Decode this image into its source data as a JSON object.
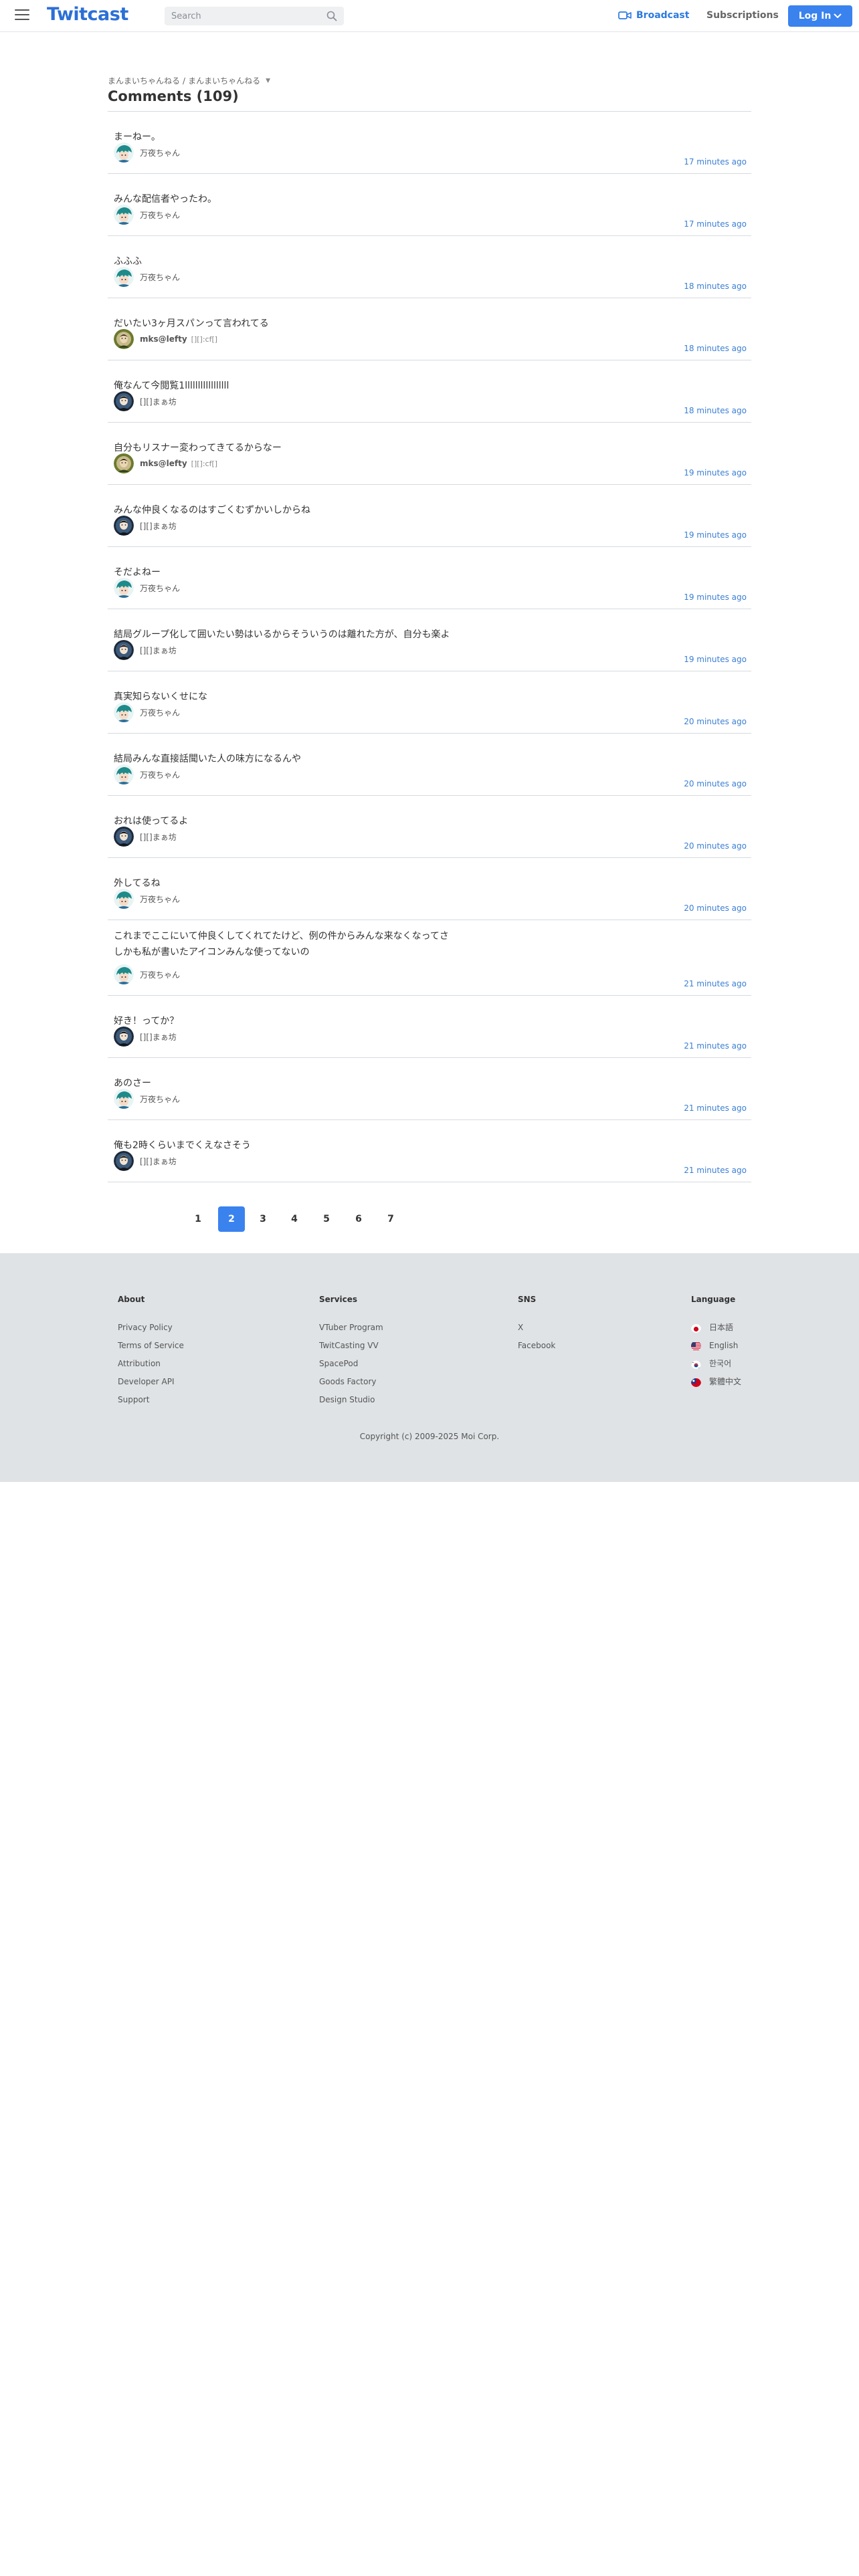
{
  "header": {
    "logo_text": "Twitcast",
    "search_placeholder": "Search",
    "broadcast_label": "Broadcast",
    "subscriptions_label": "Subscriptions",
    "login_label": "Log In",
    "brand_color": "#3a82ee"
  },
  "breadcrumb": {
    "parent": "まんまいちゃんねる",
    "current": "まんまいちゃんねる"
  },
  "page_title": "Comments (109)",
  "comments": [
    {
      "message": "まーねー。",
      "user": "万夜ちゃん",
      "screen": "",
      "time": "17 minutes ago",
      "avatar": "teal-hair-icon"
    },
    {
      "message": "みんな配信者やったわ。",
      "user": "万夜ちゃん",
      "screen": "",
      "time": "17 minutes ago",
      "avatar": "teal-hair-icon"
    },
    {
      "message": "ふふふ",
      "user": "万夜ちゃん",
      "screen": "",
      "time": "18 minutes ago",
      "avatar": "teal-hair-icon"
    },
    {
      "message": "だいたい3ヶ月スパンって言われてる",
      "user": "mks@lefty",
      "screen": "[][]:cf[]",
      "time": "18 minutes ago",
      "avatar": "green-portrait-icon"
    },
    {
      "message": "俺なんて今閲覧1lllllllllllllllll",
      "user": "[][]まぁ坊",
      "screen": "",
      "time": "18 minutes ago",
      "avatar": "dark-portrait-icon"
    },
    {
      "message": "自分もリスナー変わってきてるからなー",
      "user": "mks@lefty",
      "screen": "[][]:cf[]",
      "time": "19 minutes ago",
      "avatar": "green-portrait-icon"
    },
    {
      "message": "みんな仲良くなるのはすごくむずかいしからね",
      "user": "[][]まぁ坊",
      "screen": "",
      "time": "19 minutes ago",
      "avatar": "dark-portrait-icon"
    },
    {
      "message": "そだよねー",
      "user": "万夜ちゃん",
      "screen": "",
      "time": "19 minutes ago",
      "avatar": "teal-hair-icon"
    },
    {
      "message": "結局グループ化して囲いたい勢はいるからそういうのは離れた方が、自分も楽よ",
      "user": "[][]まぁ坊",
      "screen": "",
      "time": "19 minutes ago",
      "avatar": "dark-portrait-icon"
    },
    {
      "message": "真実知らないくせにな",
      "user": "万夜ちゃん",
      "screen": "",
      "time": "20 minutes ago",
      "avatar": "teal-hair-icon"
    },
    {
      "message": "結局みんな直接話聞いた人の味方になるんや",
      "user": "万夜ちゃん",
      "screen": "",
      "time": "20 minutes ago",
      "avatar": "teal-hair-icon"
    },
    {
      "message": "おれは使ってるよ",
      "user": "[][]まぁ坊",
      "screen": "",
      "time": "20 minutes ago",
      "avatar": "dark-portrait-icon"
    },
    {
      "message": "外してるね",
      "user": "万夜ちゃん",
      "screen": "",
      "time": "20 minutes ago",
      "avatar": "teal-hair-icon"
    },
    {
      "message": "これまでここにいて仲良くしてくれてたけど、例の件からみんな来なくなってさ\nしかも私が書いたアイコンみんな使ってないの",
      "user": "万夜ちゃん",
      "screen": "",
      "time": "21 minutes ago",
      "avatar": "teal-hair-icon",
      "tall": true
    },
    {
      "message": "好き！ってか？",
      "user": "[][]まぁ坊",
      "screen": "",
      "time": "21 minutes ago",
      "avatar": "dark-portrait-icon"
    },
    {
      "message": "あのさー",
      "user": "万夜ちゃん",
      "screen": "",
      "time": "21 minutes ago",
      "avatar": "teal-hair-icon"
    },
    {
      "message": "俺も2時くらいまでくえなさそう",
      "user": "[][]まぁ坊",
      "screen": "",
      "time": "21 minutes ago",
      "avatar": "dark-portrait-icon"
    }
  ],
  "pagination": {
    "pages": [
      "1",
      "2",
      "3",
      "4",
      "5",
      "6",
      "7"
    ],
    "current": "2"
  },
  "footer": {
    "about": {
      "heading": "About",
      "links": [
        "Privacy Policy",
        "Terms of Service",
        "Attribution",
        "Developer API",
        "Support"
      ]
    },
    "services": {
      "heading": "Services",
      "links": [
        "VTuber Program",
        "TwitCasting VV",
        "SpacePod",
        "Goods Factory",
        "Design Studio"
      ]
    },
    "sns": {
      "heading": "SNS",
      "links": [
        "X",
        "Facebook"
      ]
    },
    "language": {
      "heading": "Language",
      "items": [
        {
          "label": "日本語",
          "flag": "japan-flag-icon"
        },
        {
          "label": "English",
          "flag": "us-flag-icon"
        },
        {
          "label": "한국어",
          "flag": "korea-flag-icon"
        },
        {
          "label": "繁體中文",
          "flag": "taiwan-flag-icon"
        }
      ]
    },
    "copyright": "Copyright (c) 2009-2025 Moi Corp."
  }
}
